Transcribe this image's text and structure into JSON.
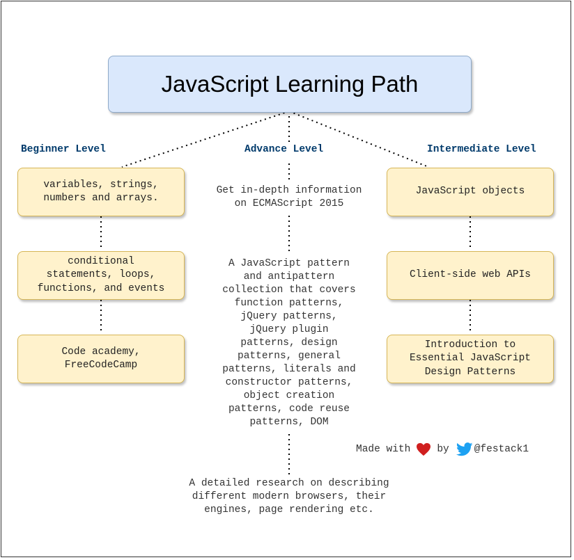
{
  "title": "JavaScript Learning Path",
  "levels": {
    "beginner": "Beginner Level",
    "advance": "Advance Level",
    "intermediate": "Intermediate Level"
  },
  "beginner": [
    "variables, strings,\nnumbers and arrays.",
    "conditional\nstatements, loops,\nfunctions, and events",
    "Code academy,\nFreeCodeCamp"
  ],
  "advance": [
    "Get in-depth information\non ECMAScript 2015",
    "A JavaScript pattern\nand antipattern\ncollection that covers\nfunction patterns,\njQuery patterns,\njQuery plugin\npatterns, design\npatterns, general\npatterns, literals and\nconstructor patterns,\nobject creation\npatterns, code reuse\npatterns, DOM",
    "A detailed research on describing\ndifferent modern browsers, their\nengines, page rendering etc."
  ],
  "intermediate": [
    "JavaScript objects",
    "Client-side web APIs",
    "Introduction to\nEssential JavaScript\nDesign Patterns"
  ],
  "footer": {
    "made_with": "Made with",
    "by": "by",
    "handle": "@festack1",
    "heart_icon": "heart-icon",
    "twitter_icon": "twitter-bird-icon"
  },
  "colors": {
    "title_fill": "#dae8fc",
    "box_fill": "#fff2cc",
    "box_border": "#d6b656",
    "level_label": "#003a6b",
    "heart": "#d01f1f",
    "twitter": "#1da1f2"
  }
}
